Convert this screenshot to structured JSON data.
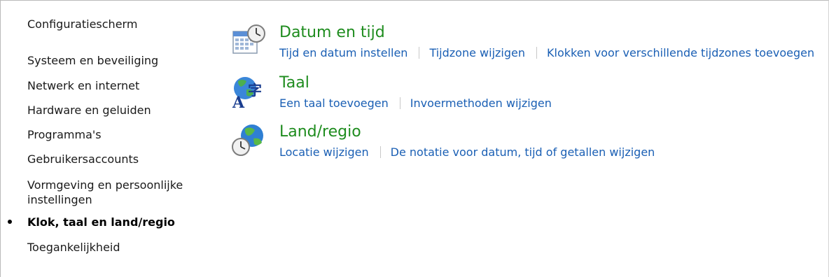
{
  "sidebar": {
    "home": "Configuratiescherm",
    "items": [
      {
        "label": "Systeem en beveiliging"
      },
      {
        "label": "Netwerk en internet"
      },
      {
        "label": "Hardware en geluiden"
      },
      {
        "label": "Programma's"
      },
      {
        "label": "Gebruikersaccounts"
      },
      {
        "label": "Vormgeving en persoonlijke instellingen"
      },
      {
        "label": "Klok, taal en land/regio",
        "active": true
      },
      {
        "label": "Toegankelijkheid"
      }
    ]
  },
  "categories": [
    {
      "title": "Datum en tijd",
      "icon": "calendar-clock-icon",
      "links": [
        "Tijd en datum instellen",
        "Tijdzone wijzigen",
        "Klokken voor verschillende tijdzones toevoegen"
      ]
    },
    {
      "title": "Taal",
      "icon": "language-globe-icon",
      "links": [
        "Een taal toevoegen",
        "Invoermethoden wijzigen"
      ]
    },
    {
      "title": "Land/regio",
      "icon": "globe-clock-icon",
      "links": [
        "Locatie wijzigen",
        "De notatie voor datum, tijd of getallen wijzigen"
      ]
    }
  ],
  "colors": {
    "category_title": "#1e8c1e",
    "link": "#1a5fb4",
    "text": "#1a1a1a"
  }
}
